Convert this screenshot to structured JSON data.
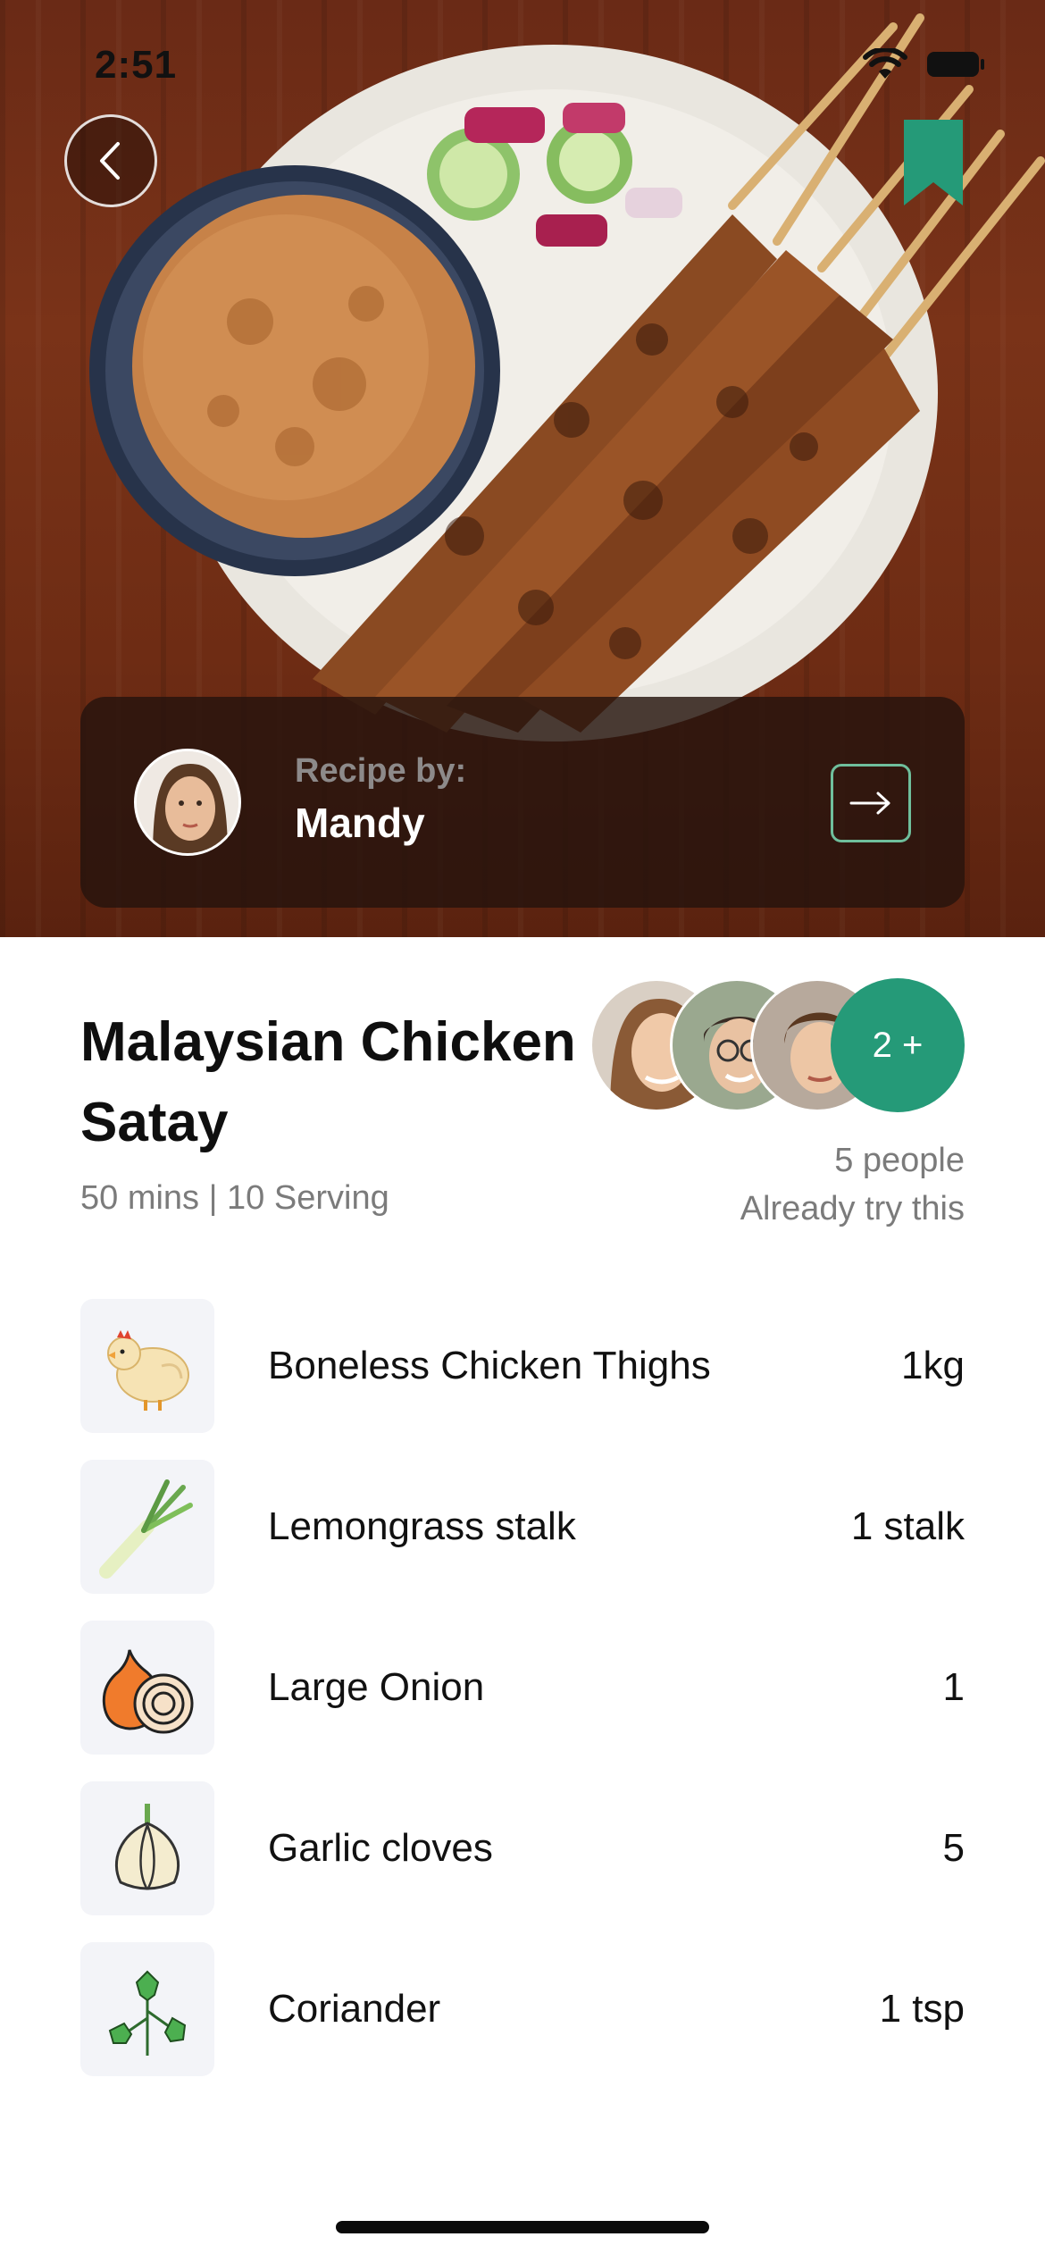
{
  "status_bar": {
    "time": "2:51"
  },
  "author": {
    "caption": "Recipe by:",
    "name": "Mandy"
  },
  "recipe": {
    "title": "Malaysian Chicken Satay",
    "meta": "50 mins | 10 Serving",
    "tried_count": "5 people",
    "tried_text": "Already try this",
    "more_avatars": "2 +"
  },
  "ingredients": [
    {
      "name": "Boneless Chicken Thighs",
      "qty": "1kg",
      "icon": "chicken-icon"
    },
    {
      "name": "Lemongrass stalk",
      "qty": "1 stalk",
      "icon": "lemongrass-icon"
    },
    {
      "name": "Large Onion",
      "qty": "1",
      "icon": "onion-icon"
    },
    {
      "name": "Garlic cloves",
      "qty": "5",
      "icon": "garlic-icon"
    },
    {
      "name": "Coriander",
      "qty": "1 tsp",
      "icon": "coriander-icon"
    }
  ],
  "colors": {
    "accent": "#259a78",
    "card": "#26140e",
    "muted": "#7b7b7b"
  }
}
